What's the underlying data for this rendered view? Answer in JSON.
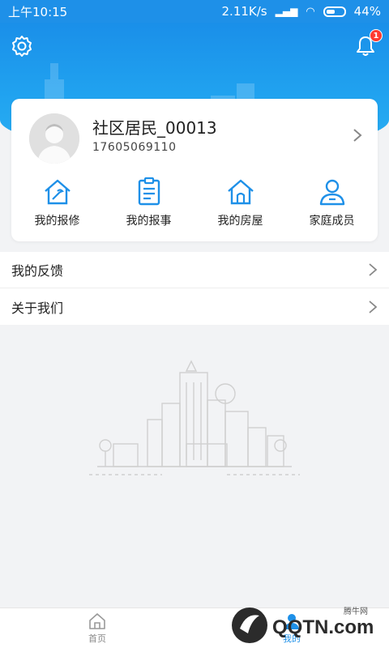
{
  "status_bar": {
    "time": "上午10:15",
    "net_speed": "2.11K/s",
    "battery": "44%"
  },
  "header": {
    "notification_count": "1"
  },
  "profile": {
    "name": "社区居民_00013",
    "phone": "17605069110"
  },
  "quick_actions": [
    {
      "label": "我的报修",
      "icon": "house-repair-icon"
    },
    {
      "label": "我的报事",
      "icon": "clipboard-icon"
    },
    {
      "label": "我的房屋",
      "icon": "house-icon"
    },
    {
      "label": "家庭成员",
      "icon": "person-icon"
    }
  ],
  "menu": [
    {
      "label": "我的反馈"
    },
    {
      "label": "关于我们"
    }
  ],
  "tabbar": {
    "home_label": "首页",
    "mine_label": "我的"
  },
  "watermark": {
    "text": "QQTN.com",
    "sub": "腾牛网"
  },
  "colors": {
    "primary": "#1e90e8",
    "background": "#f2f3f5",
    "badge": "#ff3b30"
  }
}
